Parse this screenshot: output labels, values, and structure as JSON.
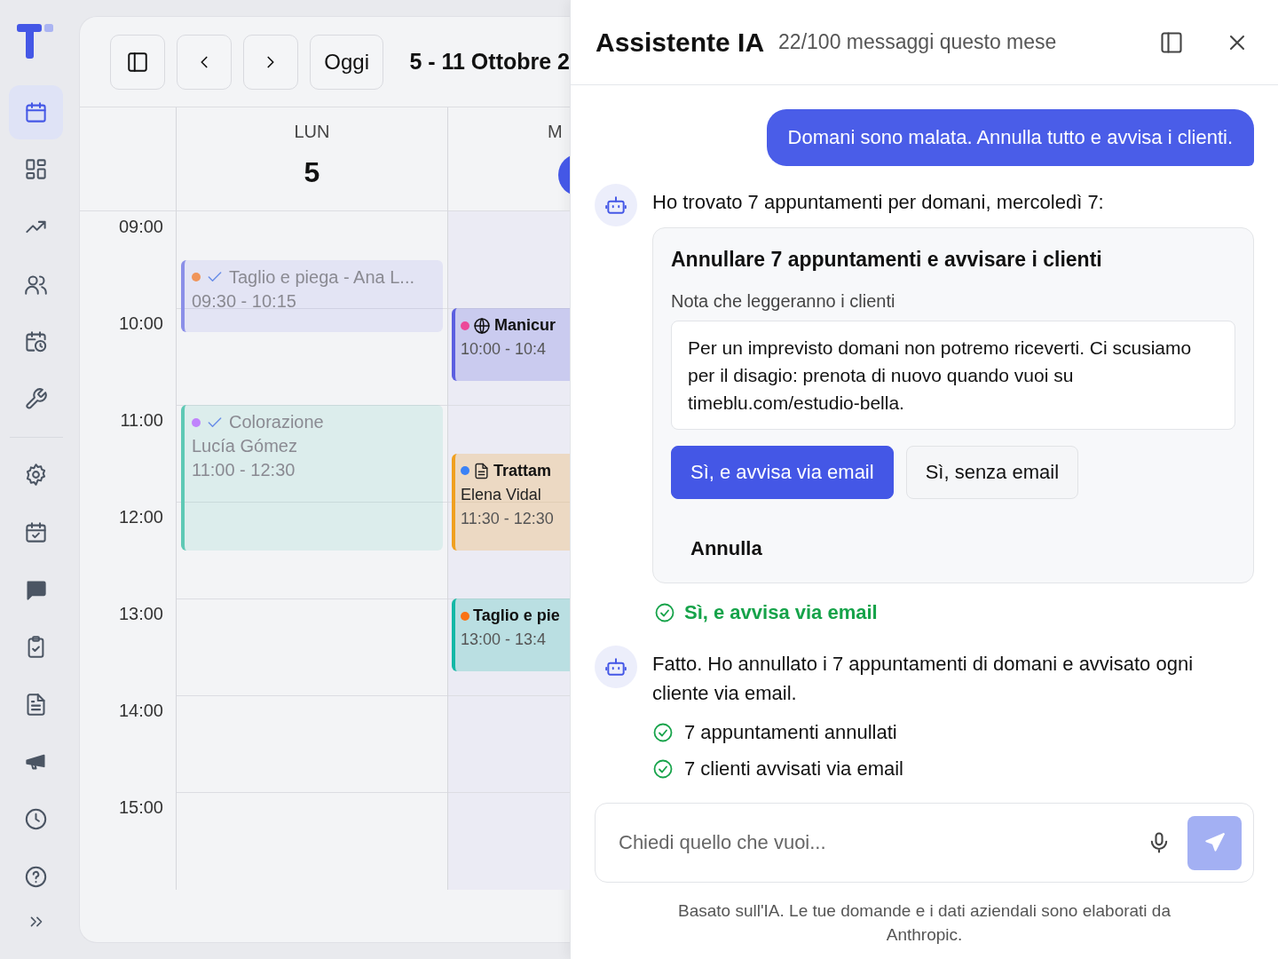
{
  "sidebar": {
    "items": [
      {
        "selected": true
      },
      {
        "selected": false
      },
      {
        "selected": false
      },
      {
        "selected": false
      },
      {
        "selected": false
      },
      {
        "selected": false
      },
      {
        "selected": false
      },
      {
        "selected": false
      },
      {
        "selected": false
      },
      {
        "selected": false
      },
      {
        "selected": false
      },
      {
        "selected": false
      },
      {
        "selected": false
      },
      {
        "selected": false
      }
    ]
  },
  "calendar": {
    "today_button": "Oggi",
    "range_title": "5 - 11 Ottobre 2",
    "hours": [
      "09:00",
      "10:00",
      "11:00",
      "12:00",
      "13:00",
      "14:00",
      "15:00"
    ],
    "days": [
      {
        "label": "LUN",
        "date": "5",
        "today": false,
        "events": [
          {
            "kind": "confirmed",
            "title": "Taglio e piega - Ana L...",
            "time": "09:30 - 10:15",
            "color": "#8b8fe8",
            "status": {
              "color": "#f0955a"
            },
            "past": true
          },
          {
            "kind": "confirmed",
            "title": "Colorazione",
            "client": "Lucía Gómez",
            "time": "11:00 - 12:30",
            "color": "#5ec9b5",
            "status": {
              "color": "#c084fc"
            },
            "past": true
          }
        ]
      },
      {
        "label": "M",
        "today": true,
        "events": [
          {
            "kind": "online",
            "title": "Manicur",
            "time": "10:00 - 10:4",
            "color": "#5b5fe0",
            "status": {
              "color": "#ec4899"
            },
            "past": false
          },
          {
            "kind": "form",
            "title": "Trattam",
            "client": "Elena Vidal",
            "time": "11:30 - 12:30",
            "color": "#f0a020",
            "status": {
              "color": "#3b82f6"
            },
            "past": false
          },
          {
            "kind": "plain",
            "title": "Taglio e pie",
            "time": "13:00 - 13:4",
            "color": "#14b8a6",
            "status": {
              "color": "#f97316"
            },
            "past": false
          }
        ]
      }
    ]
  },
  "assistant": {
    "title": "Assistente IA",
    "usage": "22/100 messaggi questo mese",
    "messages": [
      {
        "kind": "user",
        "text": "Domani sono malata. Annulla tutto e avvisa i clienti."
      },
      {
        "kind": "bot",
        "text": "Ho trovato 7 appuntamenti per domani, mercoledì 7:",
        "action": {
          "title": "Annullare 7 appuntamenti e avvisare i clienti",
          "note_label": "Nota che leggeranno i clienti",
          "note": "Per un imprevisto domani non potremo riceverti. Ci scusiamo per il disagio: prenota di nuovo quando vuoi su timeblu.com/estudio-bella.",
          "buttons": [
            {
              "label": "Sì, e avvisa via email",
              "kind": "primary"
            },
            {
              "label": "Sì, senza email",
              "kind": "secondary"
            },
            {
              "label": "Annulla",
              "kind": "plain"
            }
          ]
        }
      },
      {
        "kind": "choice",
        "text": "Sì, e avvisa via email"
      },
      {
        "kind": "bot",
        "text": "Fatto. Ho annullato i 7 appuntamenti di domani e avvisato ogni cliente via email.",
        "results": [
          "7 appuntamenti annullati",
          "7 clienti avvisati via email"
        ]
      }
    ],
    "composer": {
      "placeholder": "Chiedi quello che vuoi...",
      "send_disabled": true
    },
    "disclaimer": "Basato sull'IA. Le tue domande e i dati aziendali sono elaborati da Anthropic."
  }
}
